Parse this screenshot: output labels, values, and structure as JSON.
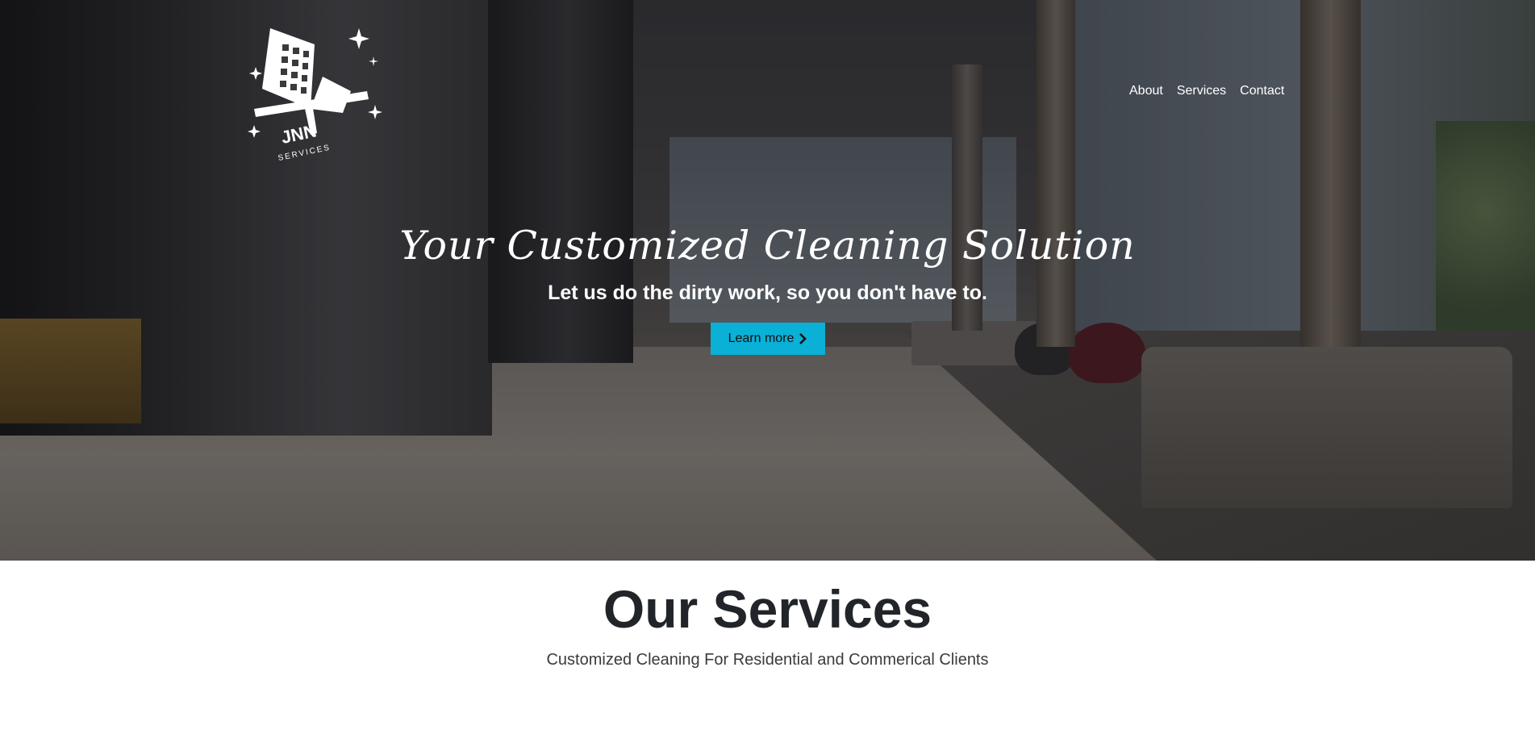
{
  "logo": {
    "text": "JNN",
    "subtext": "SERVICES",
    "icon": "building-squeegee-logo"
  },
  "nav": {
    "items": [
      "About",
      "Services",
      "Contact"
    ]
  },
  "hero": {
    "title": "Your Customized Cleaning Solution",
    "subtitle": "Let us do the dirty work, so you don't have to.",
    "button_label": "Learn more",
    "button_icon": "chevron-right-icon",
    "button_color": "#0ab0d6"
  },
  "services": {
    "heading": "Our Services",
    "subheading": "Customized Cleaning For Residential and Commerical Clients"
  }
}
